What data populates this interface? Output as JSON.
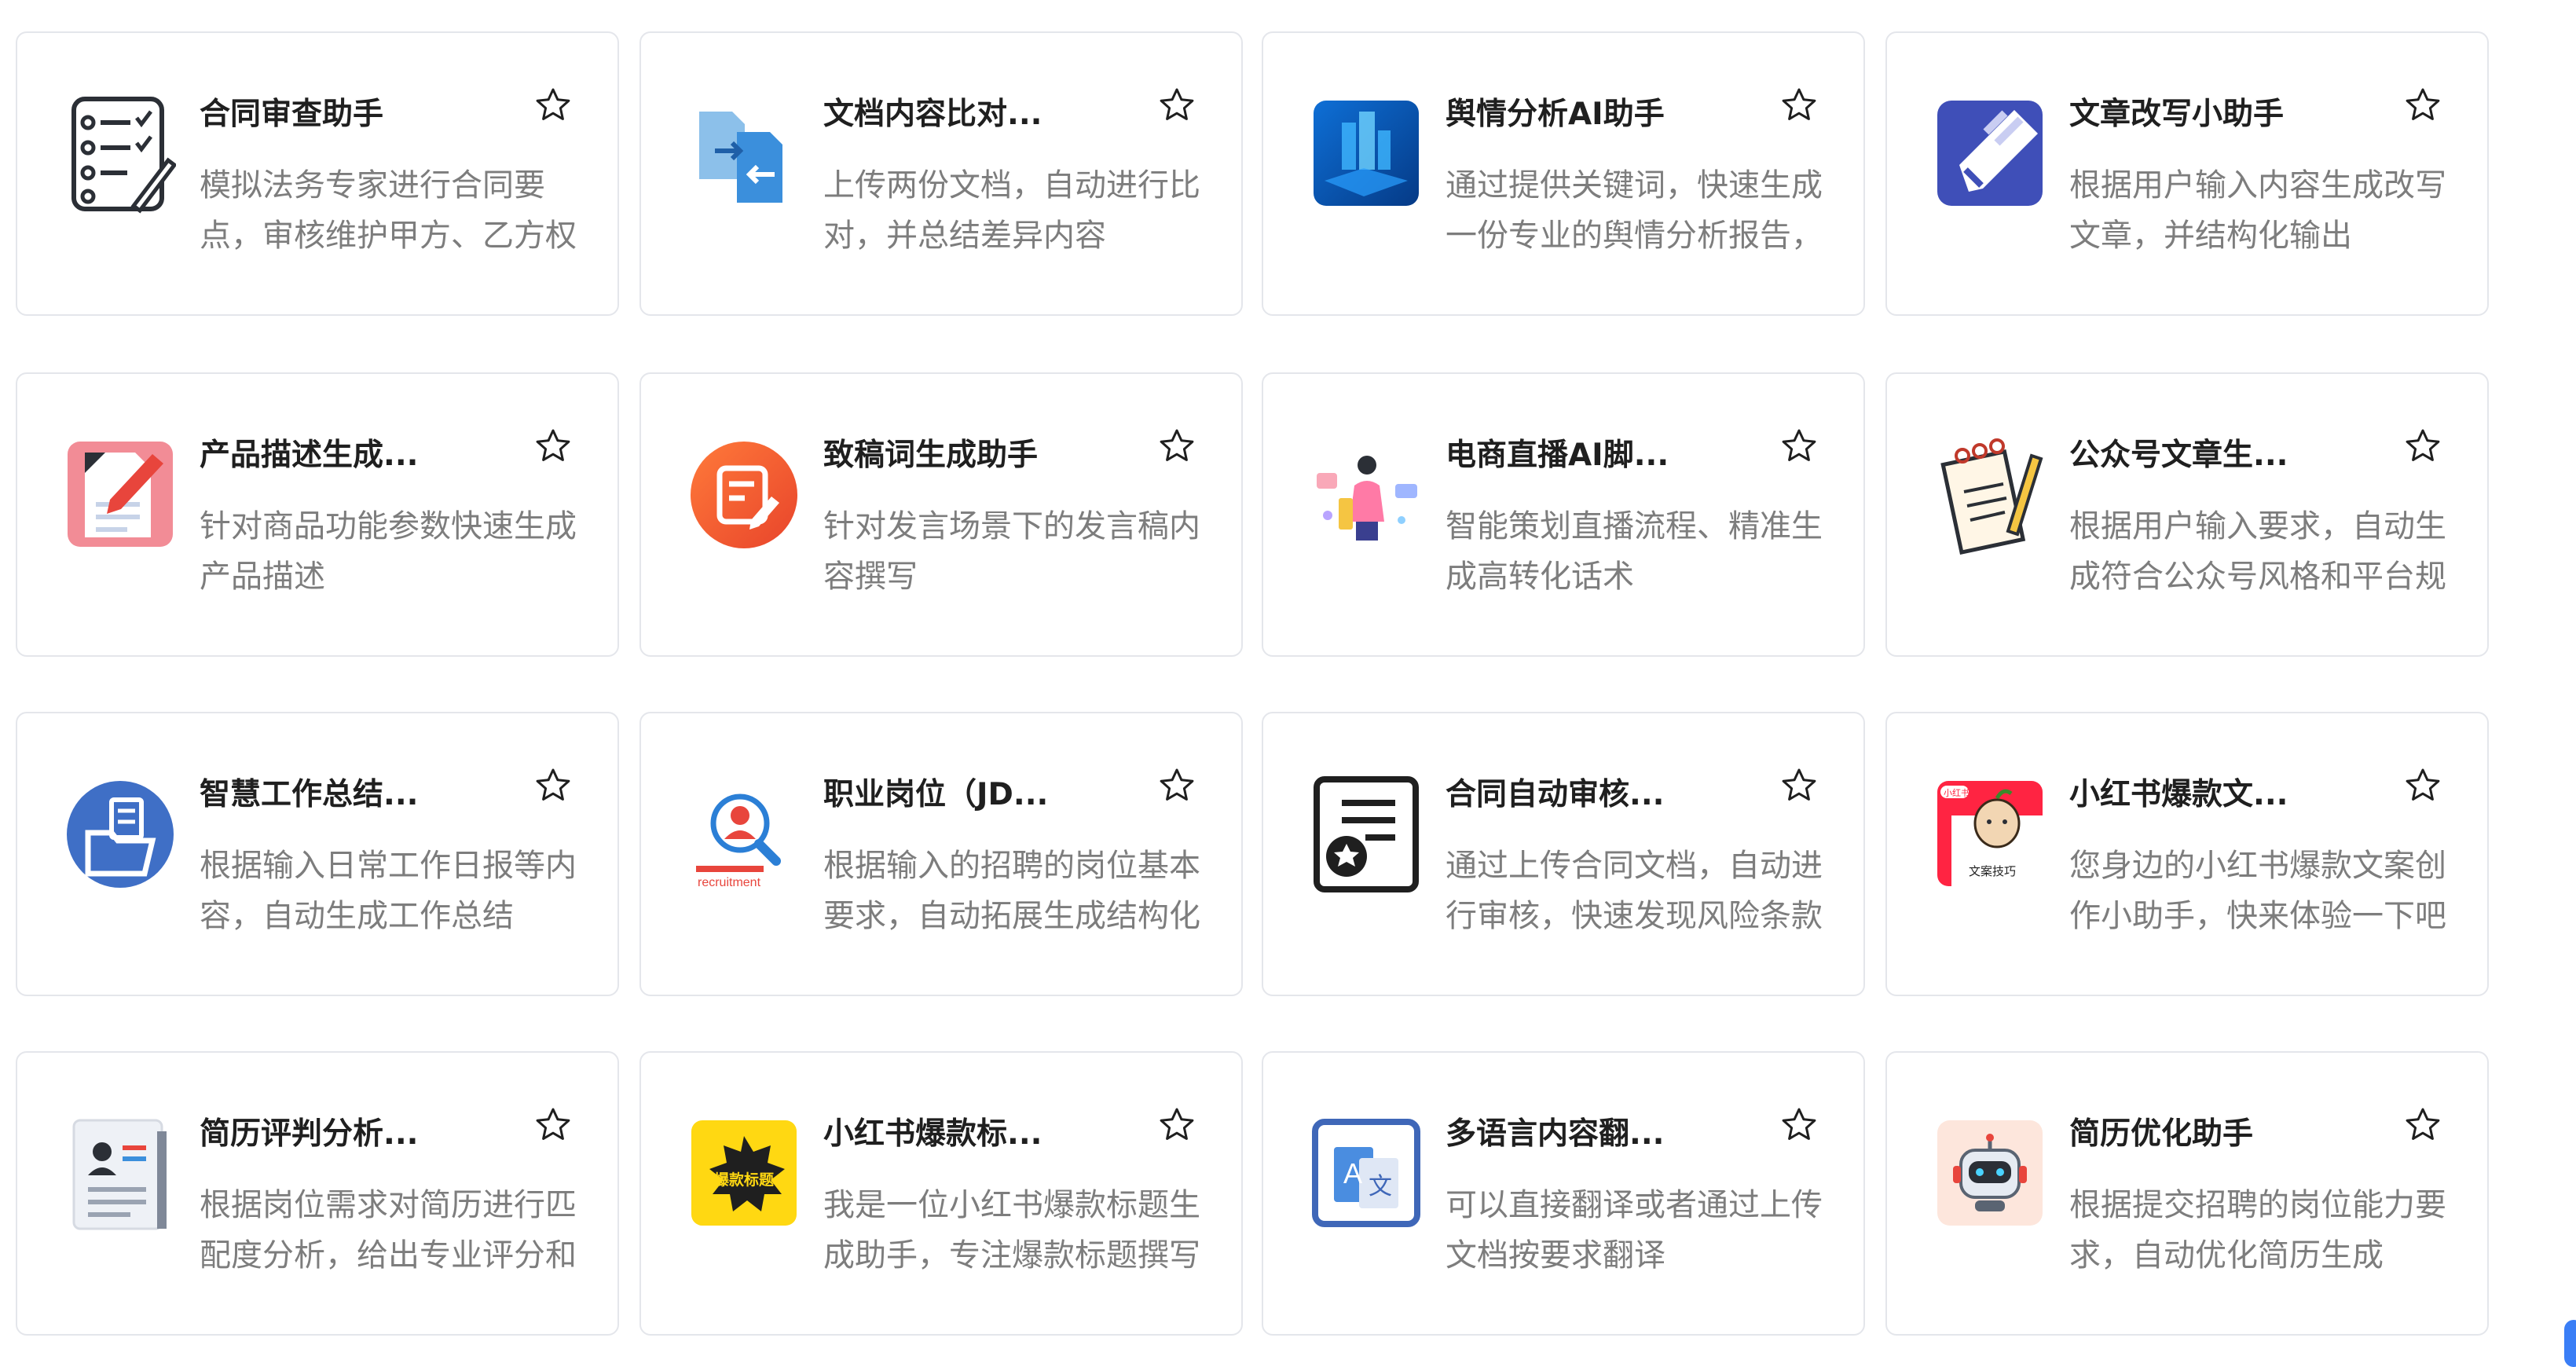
{
  "cards": [
    {
      "title": "合同审查助手",
      "desc": "模拟法务专家进行合同要点，审核维护甲方、乙方权益的...",
      "icon": "checklist-pen-icon"
    },
    {
      "title": "文档内容比对...",
      "desc": "上传两份文档，自动进行比对，并总结差异内容",
      "icon": "document-compare-icon"
    },
    {
      "title": "舆情分析AI助手",
      "desc": "通过提供关键词，快速生成一份专业的舆情分析报告，助...",
      "icon": "analytics-city-icon"
    },
    {
      "title": "文章改写小助手",
      "desc": "根据用户输入内容生成改写文章，并结构化输出",
      "icon": "pencil-rewrite-icon"
    },
    {
      "title": "产品描述生成...",
      "desc": "针对商品功能参数快速生成产品描述",
      "icon": "paper-pencil-icon"
    },
    {
      "title": "致稿词生成助手",
      "desc": "针对发言场景下的发言稿内容撰写",
      "icon": "speech-draft-icon"
    },
    {
      "title": "电商直播AI脚...",
      "desc": "智能策划直播流程、精准生成高转化话术",
      "icon": "livestream-host-icon"
    },
    {
      "title": "公众号文章生...",
      "desc": "根据用户输入要求，自动生成符合公众号风格和平台规则...",
      "icon": "notepad-pencil-icon"
    },
    {
      "title": "智慧工作总结...",
      "desc": "根据输入日常工作日报等内容，自动生成工作总结",
      "icon": "folder-report-icon"
    },
    {
      "title": "职业岗位（JD...",
      "desc": "根据输入的招聘的岗位基本要求，自动拓展生成结构化的...",
      "icon": "recruitment-search-icon"
    },
    {
      "title": "合同自动审核...",
      "desc": "通过上传合同文档，自动进行审核，快速发现风险条款并...",
      "icon": "contract-star-icon"
    },
    {
      "title": "小红书爆款文...",
      "desc": "您身边的小红书爆款文案创作小助手，快来体验一下吧~",
      "icon": "xiaohongshu-mascot-icon"
    },
    {
      "title": "简历评判分析...",
      "desc": "根据岗位需求对简历进行匹配度分析，给出专业评分和参...",
      "icon": "resume-profile-icon"
    },
    {
      "title": "小红书爆款标...",
      "desc": "我是一位小红书爆款标题生成助手，专注爆款标题撰写~",
      "icon": "explosive-title-icon"
    },
    {
      "title": "多语言内容翻...",
      "desc": "可以直接翻译或者通过上传文档按要求翻译",
      "icon": "translate-icon"
    },
    {
      "title": "简历优化助手",
      "desc": "根据提交招聘的岗位能力要求，自动优化简历生成",
      "icon": "robot-icon"
    }
  ],
  "icon_texts": {
    "recruitment": "recruitment",
    "xiaohongshu_badge": "小红书",
    "xiaohongshu_caption": "文案技巧",
    "explosive_title": "爆款标题",
    "translate_letter": "A",
    "translate_char": "文"
  },
  "colors": {
    "title": "#1f1f1f",
    "desc": "#7d7d7d",
    "border": "#e4e6eb",
    "accent_blue": "#3a7ef6"
  }
}
